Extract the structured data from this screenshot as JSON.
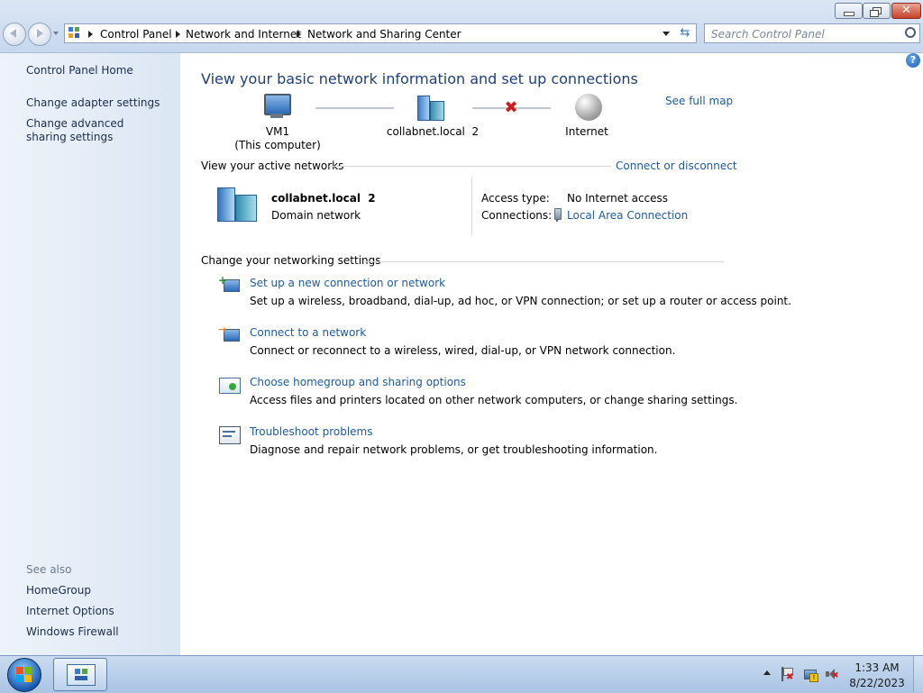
{
  "window": {
    "breadcrumb": [
      "Control Panel",
      "Network and Internet",
      "Network and Sharing Center"
    ],
    "search_placeholder": "Search Control Panel"
  },
  "sidebar": {
    "home": "Control Panel Home",
    "items": [
      "Change adapter settings",
      "Change advanced sharing settings"
    ],
    "see_also_heading": "See also",
    "see_also": [
      "HomeGroup",
      "Internet Options",
      "Windows Firewall"
    ]
  },
  "main": {
    "heading": "View your basic network information and set up connections",
    "see_full_map": "See full map",
    "map": {
      "computer_name": "VM1",
      "computer_sub": "(This computer)",
      "network_name": "collabnet.local  2",
      "internet": "Internet"
    },
    "active_networks_label": "View your active networks",
    "connect_or_disconnect": "Connect or disconnect",
    "network": {
      "name": "collabnet.local  2",
      "type": "Domain network",
      "access_type_label": "Access type:",
      "access_type_value": "No Internet access",
      "connections_label": "Connections:",
      "connections_value": "Local Area Connection"
    },
    "settings_label": "Change your networking settings",
    "tasks": [
      {
        "title": "Set up a new connection or network",
        "desc": "Set up a wireless, broadband, dial-up, ad hoc, or VPN connection; or set up a router or access point."
      },
      {
        "title": "Connect to a network",
        "desc": "Connect or reconnect to a wireless, wired, dial-up, or VPN network connection."
      },
      {
        "title": "Choose homegroup and sharing options",
        "desc": "Access files and printers located on other network computers, or change sharing settings."
      },
      {
        "title": "Troubleshoot problems",
        "desc": "Diagnose and repair network problems, or get troubleshooting information."
      }
    ]
  },
  "taskbar": {
    "time": "1:33 AM",
    "date": "8/22/2023"
  }
}
